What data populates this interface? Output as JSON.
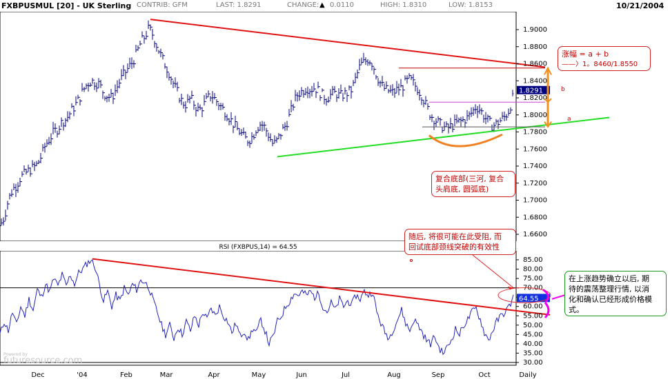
{
  "header": {
    "symbol": "FXBPUSMUL [20] - UK Sterling",
    "contrib": "CONTRIB: GFM",
    "last": "LAST: 1.8291",
    "change_label": "CHANGE:",
    "change_value": "0.0110",
    "high": "HIGH: 1.8310",
    "low": "LOW: 1.8153",
    "date": "10/21/2004"
  },
  "watermark": "futuresource.com",
  "watermark_small": "Powered by",
  "chart_data": [
    {
      "type": "candlestick",
      "title": "FXBPUSMUL [20] - UK Sterling",
      "ylim": [
        1.65,
        1.92
      ],
      "y_ticks": [
        "1.9000",
        "1.8800",
        "1.8600",
        "1.8400",
        "1.8200",
        "1.8000",
        "1.7800",
        "1.7600",
        "1.7400",
        "1.7200",
        "1.7000",
        "1.6800",
        "1.6600"
      ],
      "y_tick_values": [
        1.9,
        1.88,
        1.86,
        1.84,
        1.82,
        1.8,
        1.78,
        1.76,
        1.74,
        1.72,
        1.7,
        1.68,
        1.66
      ],
      "x_labels": [
        "Dec",
        "'04",
        "Feb",
        "Mar",
        "Apr",
        "May",
        "Jun",
        "Jul",
        "Aug",
        "Sep",
        "Oct",
        "Daily"
      ],
      "last_value_label": "1.8291",
      "price_path": [
        [
          0,
          1.67
        ],
        [
          6,
          1.68
        ],
        [
          12,
          1.7
        ],
        [
          18,
          1.712
        ],
        [
          24,
          1.718
        ],
        [
          30,
          1.727
        ],
        [
          36,
          1.731
        ],
        [
          42,
          1.735
        ],
        [
          48,
          1.738
        ],
        [
          54,
          1.742
        ],
        [
          60,
          1.752
        ],
        [
          66,
          1.765
        ],
        [
          72,
          1.772
        ],
        [
          78,
          1.78
        ],
        [
          84,
          1.784
        ],
        [
          90,
          1.792
        ],
        [
          96,
          1.795
        ],
        [
          102,
          1.803
        ],
        [
          108,
          1.81
        ],
        [
          114,
          1.818
        ],
        [
          120,
          1.828
        ],
        [
          126,
          1.836
        ],
        [
          132,
          1.84
        ],
        [
          138,
          1.838
        ],
        [
          144,
          1.836
        ],
        [
          150,
          1.826
        ],
        [
          156,
          1.822
        ],
        [
          162,
          1.82
        ],
        [
          168,
          1.83
        ],
        [
          174,
          1.84
        ],
        [
          180,
          1.848
        ],
        [
          186,
          1.855
        ],
        [
          192,
          1.862
        ],
        [
          198,
          1.872
        ],
        [
          204,
          1.885
        ],
        [
          210,
          1.892
        ],
        [
          216,
          1.902
        ],
        [
          222,
          1.893
        ],
        [
          228,
          1.88
        ],
        [
          234,
          1.868
        ],
        [
          240,
          1.858
        ],
        [
          246,
          1.848
        ],
        [
          252,
          1.835
        ],
        [
          258,
          1.825
        ],
        [
          264,
          1.815
        ],
        [
          270,
          1.812
        ],
        [
          276,
          1.82
        ],
        [
          282,
          1.812
        ],
        [
          288,
          1.805
        ],
        [
          294,
          1.81
        ],
        [
          300,
          1.818
        ],
        [
          306,
          1.824
        ],
        [
          312,
          1.818
        ],
        [
          318,
          1.812
        ],
        [
          324,
          1.806
        ],
        [
          330,
          1.8
        ],
        [
          336,
          1.792
        ],
        [
          342,
          1.785
        ],
        [
          348,
          1.78
        ],
        [
          354,
          1.773
        ],
        [
          360,
          1.77
        ],
        [
          366,
          1.775
        ],
        [
          372,
          1.785
        ],
        [
          378,
          1.79
        ],
        [
          384,
          1.785
        ],
        [
          390,
          1.775
        ],
        [
          396,
          1.765
        ],
        [
          402,
          1.77
        ],
        [
          408,
          1.78
        ],
        [
          414,
          1.788
        ],
        [
          420,
          1.8
        ],
        [
          426,
          1.815
        ],
        [
          432,
          1.825
        ],
        [
          438,
          1.828
        ],
        [
          444,
          1.832
        ],
        [
          450,
          1.83
        ],
        [
          456,
          1.832
        ],
        [
          462,
          1.828
        ],
        [
          468,
          1.822
        ],
        [
          474,
          1.82
        ],
        [
          480,
          1.824
        ],
        [
          486,
          1.826
        ],
        [
          492,
          1.822
        ],
        [
          498,
          1.824
        ],
        [
          504,
          1.826
        ],
        [
          510,
          1.83
        ],
        [
          516,
          1.844
        ],
        [
          522,
          1.858
        ],
        [
          528,
          1.862
        ],
        [
          534,
          1.866
        ],
        [
          540,
          1.86
        ],
        [
          546,
          1.846
        ],
        [
          552,
          1.836
        ],
        [
          558,
          1.83
        ],
        [
          564,
          1.828
        ],
        [
          570,
          1.826
        ],
        [
          576,
          1.83
        ],
        [
          582,
          1.832
        ],
        [
          588,
          1.838
        ],
        [
          594,
          1.842
        ],
        [
          600,
          1.836
        ],
        [
          606,
          1.83
        ],
        [
          612,
          1.822
        ],
        [
          618,
          1.81
        ],
        [
          624,
          1.8
        ],
        [
          630,
          1.795
        ],
        [
          636,
          1.79
        ],
        [
          642,
          1.786
        ],
        [
          648,
          1.784
        ],
        [
          654,
          1.787
        ],
        [
          660,
          1.79
        ],
        [
          666,
          1.792
        ],
        [
          672,
          1.794
        ],
        [
          678,
          1.797
        ],
        [
          684,
          1.803
        ],
        [
          690,
          1.81
        ],
        [
          696,
          1.806
        ],
        [
          702,
          1.798
        ],
        [
          708,
          1.792
        ],
        [
          714,
          1.787
        ],
        [
          720,
          1.79
        ],
        [
          726,
          1.794
        ],
        [
          732,
          1.798
        ],
        [
          738,
          1.806
        ],
        [
          744,
          1.822
        ]
      ],
      "lines": [
        {
          "name": "resistance",
          "color": "#e01010",
          "from": [
            218,
            1.912
          ],
          "to": [
            790,
            1.856
          ]
        },
        {
          "name": "support",
          "color": "#22dd22",
          "from": [
            402,
            1.751
          ],
          "to": [
            883,
            1.797
          ]
        },
        {
          "name": "neckline",
          "color": "#cc44cc",
          "from": [
            622,
            1.815
          ],
          "to": [
            790,
            1.815
          ]
        },
        {
          "name": "target",
          "color": "#c00000",
          "from": [
            578,
            1.855
          ],
          "to": [
            790,
            1.855
          ]
        },
        {
          "name": "base",
          "color": "#555555",
          "from": [
            612,
            1.786
          ],
          "to": [
            790,
            1.786
          ]
        }
      ],
      "annotations": {
        "target_box": [
          "涨幅 = a + b",
          "——〉1。8460/1.8550"
        ],
        "label_a": "a",
        "label_b": "b",
        "pattern_box": [
          "复合底部(三河, 复合",
          "头肩底, 圆弧底)"
        ]
      }
    },
    {
      "type": "line",
      "title": "RSI (FXBPUS,14) = 64.55",
      "ylim": [
        27,
        90
      ],
      "y_ticks": [
        "85.00",
        "80.00",
        "75.00",
        "70.00",
        "65.00",
        "60.00",
        "55.00",
        "50.00",
        "45.00",
        "40.00",
        "35.00",
        "30.00"
      ],
      "y_tick_values": [
        85,
        80,
        75,
        70,
        65,
        60,
        55,
        50,
        45,
        40,
        35,
        30
      ],
      "ref_lines": [
        70,
        30
      ],
      "last_value_label": "64.55",
      "rsi_path": [
        [
          0,
          45
        ],
        [
          6,
          52
        ],
        [
          12,
          47
        ],
        [
          18,
          57
        ],
        [
          24,
          50
        ],
        [
          30,
          60
        ],
        [
          36,
          55
        ],
        [
          42,
          64
        ],
        [
          48,
          58
        ],
        [
          54,
          69
        ],
        [
          60,
          65
        ],
        [
          66,
          72
        ],
        [
          72,
          68
        ],
        [
          78,
          75
        ],
        [
          84,
          71
        ],
        [
          90,
          77
        ],
        [
          96,
          71
        ],
        [
          102,
          77
        ],
        [
          108,
          72
        ],
        [
          114,
          78
        ],
        [
          120,
          80
        ],
        [
          126,
          83
        ],
        [
          132,
          85
        ],
        [
          138,
          81
        ],
        [
          144,
          72
        ],
        [
          150,
          63
        ],
        [
          156,
          68
        ],
        [
          162,
          60
        ],
        [
          168,
          66
        ],
        [
          174,
          63
        ],
        [
          180,
          70
        ],
        [
          186,
          66
        ],
        [
          192,
          72
        ],
        [
          198,
          69
        ],
        [
          204,
          74
        ],
        [
          210,
          73
        ],
        [
          216,
          70
        ],
        [
          222,
          63
        ],
        [
          228,
          57
        ],
        [
          234,
          50
        ],
        [
          240,
          45
        ],
        [
          246,
          50
        ],
        [
          252,
          43
        ],
        [
          258,
          49
        ],
        [
          264,
          45
        ],
        [
          270,
          52
        ],
        [
          276,
          47
        ],
        [
          282,
          55
        ],
        [
          288,
          50
        ],
        [
          294,
          57
        ],
        [
          300,
          53
        ],
        [
          306,
          59
        ],
        [
          312,
          55
        ],
        [
          318,
          60
        ],
        [
          324,
          55
        ],
        [
          330,
          52
        ],
        [
          336,
          46
        ],
        [
          342,
          51
        ],
        [
          348,
          44
        ],
        [
          354,
          47
        ],
        [
          360,
          42
        ],
        [
          366,
          48
        ],
        [
          372,
          46
        ],
        [
          378,
          53
        ],
        [
          384,
          47
        ],
        [
          390,
          40
        ],
        [
          396,
          44
        ],
        [
          402,
          52
        ],
        [
          408,
          55
        ],
        [
          414,
          60
        ],
        [
          420,
          63
        ],
        [
          426,
          67
        ],
        [
          432,
          66
        ],
        [
          438,
          68
        ],
        [
          444,
          66
        ],
        [
          450,
          68
        ],
        [
          456,
          65
        ],
        [
          462,
          67
        ],
        [
          468,
          60
        ],
        [
          474,
          57
        ],
        [
          480,
          62
        ],
        [
          486,
          58
        ],
        [
          492,
          64
        ],
        [
          498,
          60
        ],
        [
          504,
          63
        ],
        [
          510,
          61
        ],
        [
          516,
          66
        ],
        [
          522,
          64
        ],
        [
          528,
          68
        ],
        [
          534,
          66
        ],
        [
          540,
          68
        ],
        [
          546,
          57
        ],
        [
          552,
          51
        ],
        [
          558,
          46
        ],
        [
          564,
          43
        ],
        [
          570,
          48
        ],
        [
          576,
          53
        ],
        [
          582,
          58
        ],
        [
          588,
          51
        ],
        [
          594,
          47
        ],
        [
          600,
          53
        ],
        [
          606,
          50
        ],
        [
          612,
          46
        ],
        [
          618,
          42
        ],
        [
          624,
          40
        ],
        [
          630,
          44
        ],
        [
          636,
          38
        ],
        [
          642,
          35
        ],
        [
          648,
          38
        ],
        [
          654,
          42
        ],
        [
          660,
          48
        ],
        [
          666,
          45
        ],
        [
          672,
          50
        ],
        [
          678,
          53
        ],
        [
          684,
          57
        ],
        [
          690,
          59
        ],
        [
          696,
          53
        ],
        [
          702,
          46
        ],
        [
          708,
          42
        ],
        [
          714,
          47
        ],
        [
          720,
          52
        ],
        [
          726,
          55
        ],
        [
          732,
          57
        ],
        [
          738,
          60
        ],
        [
          744,
          65
        ]
      ],
      "lines": [
        {
          "name": "rsi-resistance",
          "color": "#e01010",
          "from": [
            134,
            85.5
          ],
          "to": [
            797,
            55.5
          ]
        }
      ],
      "annotations": {
        "warning_box": [
          "随后, 将很可能在此受阻, 而",
          "回试底部颈线突破的有效性"
        ],
        "green_box": [
          "在上涨趋势确立以后, 期",
          "待的震荡整理行情, 以消",
          "化和确认已经形成价格模",
          "式。"
        ]
      }
    }
  ]
}
